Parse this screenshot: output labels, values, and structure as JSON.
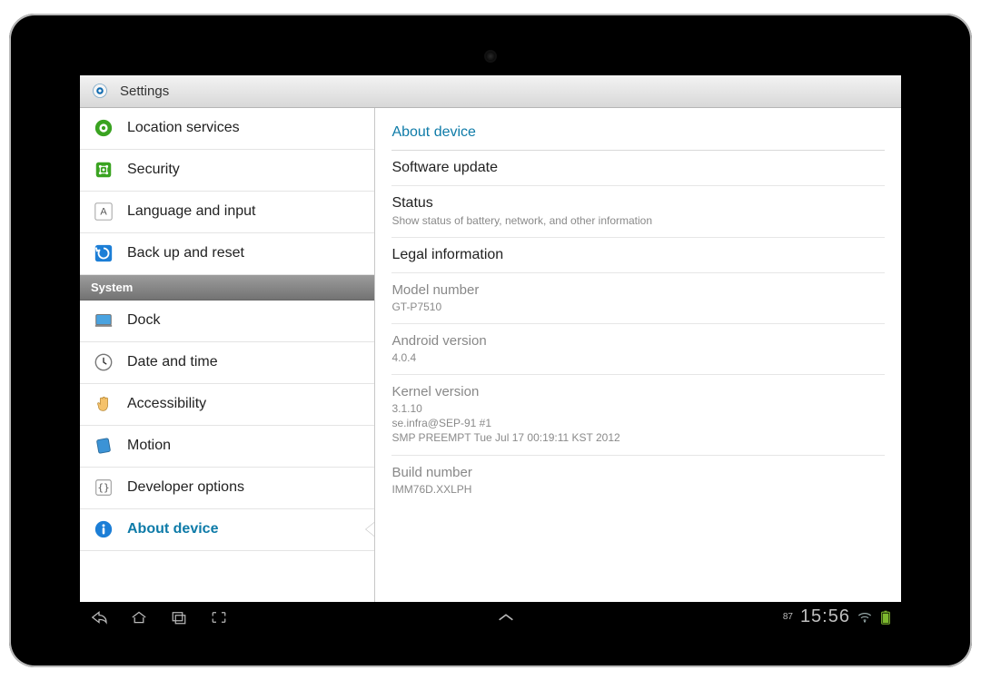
{
  "header": {
    "title": "Settings"
  },
  "sidebar": {
    "items": [
      {
        "label": "Location services",
        "icon": "location"
      },
      {
        "label": "Security",
        "icon": "security"
      },
      {
        "label": "Language and input",
        "icon": "language"
      },
      {
        "label": "Back up and reset",
        "icon": "backup"
      }
    ],
    "section_label": "System",
    "system_items": [
      {
        "label": "Dock",
        "icon": "dock"
      },
      {
        "label": "Date and time",
        "icon": "clock"
      },
      {
        "label": "Accessibility",
        "icon": "hand"
      },
      {
        "label": "Motion",
        "icon": "motion"
      },
      {
        "label": "Developer options",
        "icon": "dev"
      },
      {
        "label": "About device",
        "icon": "info",
        "selected": true
      }
    ]
  },
  "detail": {
    "header": "About device",
    "rows": [
      {
        "title": "Software update",
        "interactable": true
      },
      {
        "title": "Status",
        "sub": "Show status of battery, network, and other information",
        "interactable": true
      },
      {
        "title": "Legal information",
        "interactable": true
      },
      {
        "title": "Model number",
        "sub": "GT-P7510",
        "readonly": true
      },
      {
        "title": "Android version",
        "sub": "4.0.4",
        "readonly": true
      },
      {
        "title": "Kernel version",
        "sub": "3.1.10\nse.infra@SEP-91 #1\nSMP PREEMPT Tue Jul 17 00:19:11 KST 2012",
        "readonly": true
      },
      {
        "title": "Build number",
        "sub": "IMM76D.XXLPH",
        "readonly": true
      }
    ]
  },
  "navbar": {
    "battery_percent": "87",
    "time": "15:56"
  }
}
